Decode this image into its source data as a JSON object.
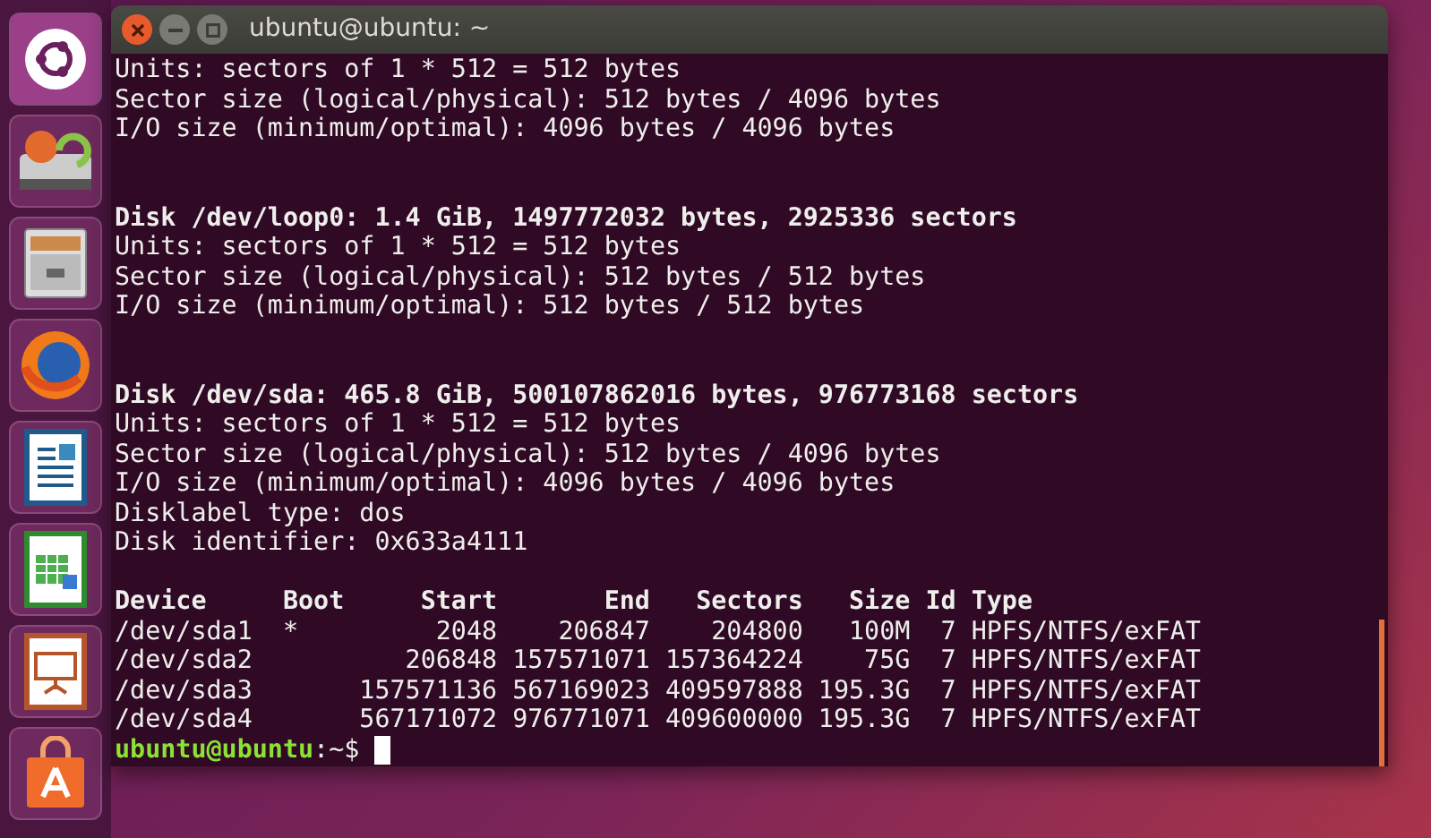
{
  "window": {
    "title": "ubuntu@ubuntu: ~"
  },
  "terminal": {
    "blocks": [
      {
        "lines": [
          {
            "text": "Units: sectors of 1 * 512 = 512 bytes",
            "bold": false
          },
          {
            "text": "Sector size (logical/physical): 512 bytes / 4096 bytes",
            "bold": false
          },
          {
            "text": "I/O size (minimum/optimal): 4096 bytes / 4096 bytes",
            "bold": false
          }
        ]
      },
      {
        "lines": [
          {
            "text": "Disk /dev/loop0: 1.4 GiB, 1497772032 bytes, 2925336 sectors",
            "bold": true
          },
          {
            "text": "Units: sectors of 1 * 512 = 512 bytes",
            "bold": false
          },
          {
            "text": "Sector size (logical/physical): 512 bytes / 512 bytes",
            "bold": false
          },
          {
            "text": "I/O size (minimum/optimal): 512 bytes / 512 bytes",
            "bold": false
          }
        ]
      },
      {
        "lines": [
          {
            "text": "Disk /dev/sda: 465.8 GiB, 500107862016 bytes, 976773168 sectors",
            "bold": true
          },
          {
            "text": "Units: sectors of 1 * 512 = 512 bytes",
            "bold": false
          },
          {
            "text": "Sector size (logical/physical): 512 bytes / 4096 bytes",
            "bold": false
          },
          {
            "text": "I/O size (minimum/optimal): 4096 bytes / 4096 bytes",
            "bold": false
          },
          {
            "text": "Disklabel type: dos",
            "bold": false
          },
          {
            "text": "Disk identifier: 0x633a4111",
            "bold": false
          }
        ]
      }
    ],
    "partition_table": {
      "header": "Device     Boot     Start       End   Sectors   Size Id Type",
      "rows": [
        "/dev/sda1  *         2048    206847    204800   100M  7 HPFS/NTFS/exFAT",
        "/dev/sda2          206848 157571071 157364224    75G  7 HPFS/NTFS/exFAT",
        "/dev/sda3       157571136 567169023 409597888 195.3G  7 HPFS/NTFS/exFAT",
        "/dev/sda4       567171072 976771071 409600000 195.3G  7 HPFS/NTFS/exFAT"
      ]
    },
    "prompt": {
      "user_host": "ubuntu@ubuntu",
      "path": ":~$"
    }
  }
}
